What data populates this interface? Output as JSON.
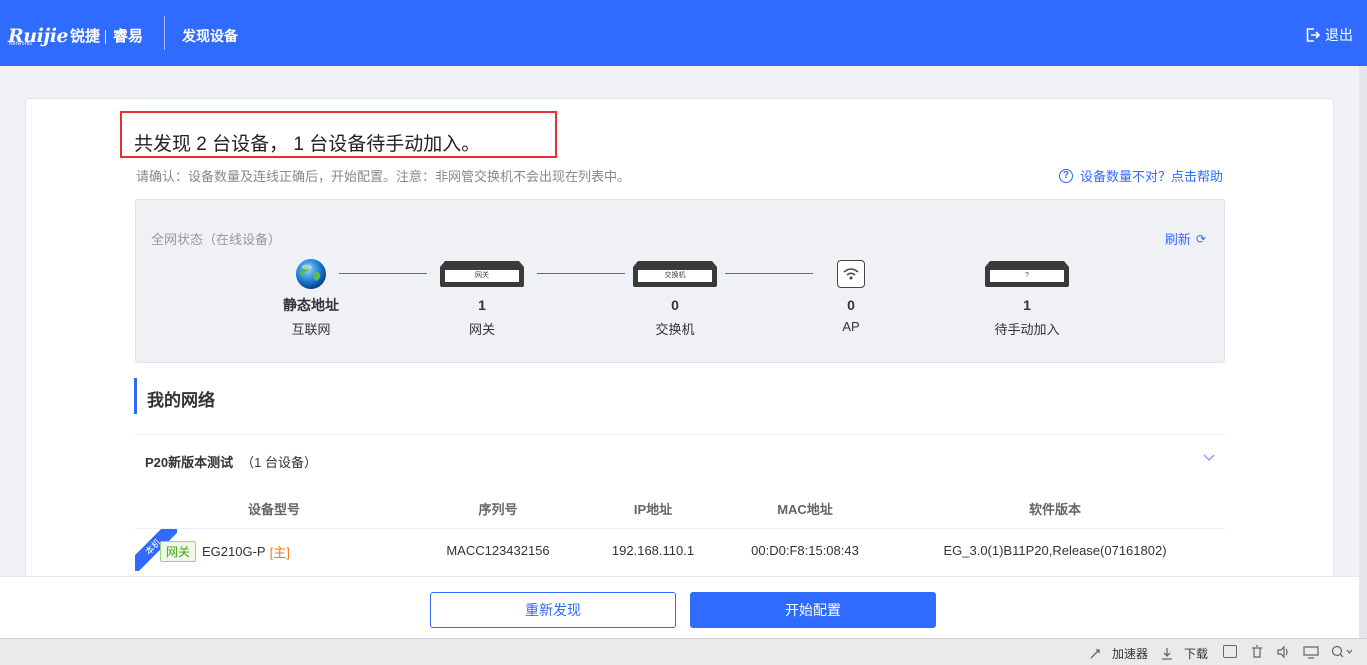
{
  "header": {
    "logo_brand": "Ruijie",
    "logo_sub": "Networks",
    "logo_cn": "锐捷",
    "logo_product": "睿易",
    "title": "发现设备",
    "logout_label": "退出"
  },
  "summary": {
    "text": "共发现 2 台设备， 1 台设备待手动加入。",
    "confirm_note": "请确认：设备数量及连线正确后，开始配置。注意：非网管交换机不会出现在列表中。",
    "help_link": "设备数量不对？点击帮助"
  },
  "network_status": {
    "title": "全网状态（在线设备）",
    "refresh_label": "刷新",
    "nodes": [
      {
        "value": "静态地址",
        "label": "互联网",
        "icon": "globe-icon"
      },
      {
        "value": "1",
        "label": "网关",
        "icon": "gateway-icon",
        "face_text": "网关"
      },
      {
        "value": "0",
        "label": "交换机",
        "icon": "switch-icon",
        "face_text": "交换机"
      },
      {
        "value": "0",
        "label": "AP",
        "icon": "wifi-ap-icon"
      },
      {
        "value": "1",
        "label": "待手动加入",
        "icon": "unknown-device-icon",
        "face_text": "?"
      }
    ]
  },
  "my_network": {
    "title": "我的网络",
    "group": {
      "name": "P20新版本测试",
      "count_text": "（1 台设备）"
    },
    "columns": [
      "设备型号",
      "序列号",
      "IP地址",
      "MAC地址",
      "软件版本"
    ],
    "rows": [
      {
        "ribbon": "本机",
        "type_tag": "网关",
        "model": "EG210G-P",
        "role": "[主]",
        "serial": "MACC123432156",
        "ip": "192.168.110.1",
        "mac": "00:D0:F8:15:08:43",
        "software": "EG_3.0(1)B11P20,Release(07161802)"
      }
    ]
  },
  "footer": {
    "rescan_label": "重新发现",
    "start_label": "开始配置"
  },
  "statusbar": {
    "accelerator_label": "加速器",
    "download_label": "下载"
  },
  "colors": {
    "primary": "#2f6bff",
    "highlight_box": "#e5302e",
    "tag_green": "#4a9c1f",
    "role_orange": "#f07b15"
  }
}
